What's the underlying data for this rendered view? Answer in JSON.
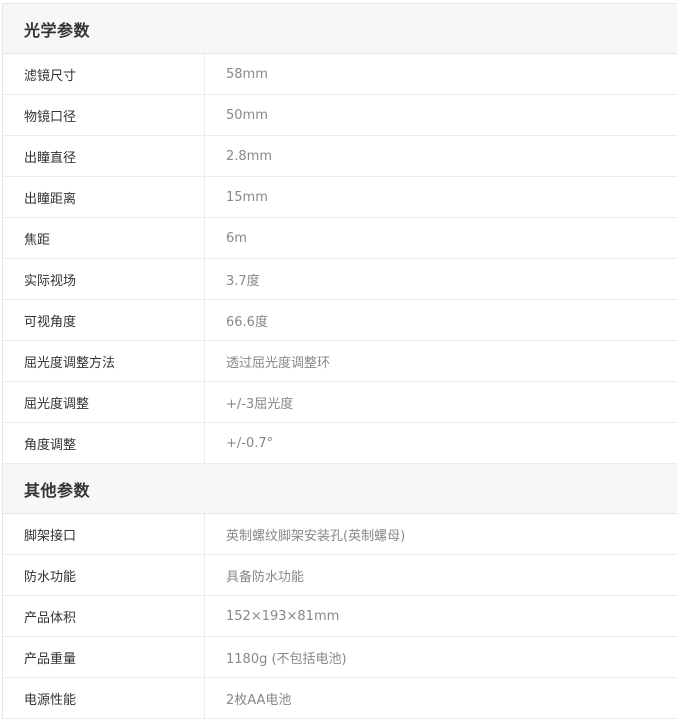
{
  "sections": [
    {
      "title": "光学参数",
      "rows": [
        {
          "name": "滤镜尺寸",
          "value": "58mm"
        },
        {
          "name": "物镜口径",
          "value": "50mm"
        },
        {
          "name": "出瞳直径",
          "value": "2.8mm"
        },
        {
          "name": "出瞳距离",
          "value": "15mm"
        },
        {
          "name": "焦距",
          "value": "6m"
        },
        {
          "name": "实际视场",
          "value": "3.7度"
        },
        {
          "name": "可视角度",
          "value": "66.6度"
        },
        {
          "name": "屈光度调整方法",
          "value": "透过屈光度调整环"
        },
        {
          "name": "屈光度调整",
          "value": "+/-3屈光度"
        },
        {
          "name": "角度调整",
          "value": "+/-0.7°"
        }
      ]
    },
    {
      "title": "其他参数",
      "rows": [
        {
          "name": "脚架接口",
          "value": "英制螺纹脚架安装孔(英制螺母)"
        },
        {
          "name": "防水功能",
          "value": "具备防水功能"
        },
        {
          "name": "产品体积",
          "value": "152×193×81mm"
        },
        {
          "name": "产品重量",
          "value": "1180g (不包括电池)"
        },
        {
          "name": "电源性能",
          "value": "2枚AA电池"
        }
      ]
    }
  ]
}
